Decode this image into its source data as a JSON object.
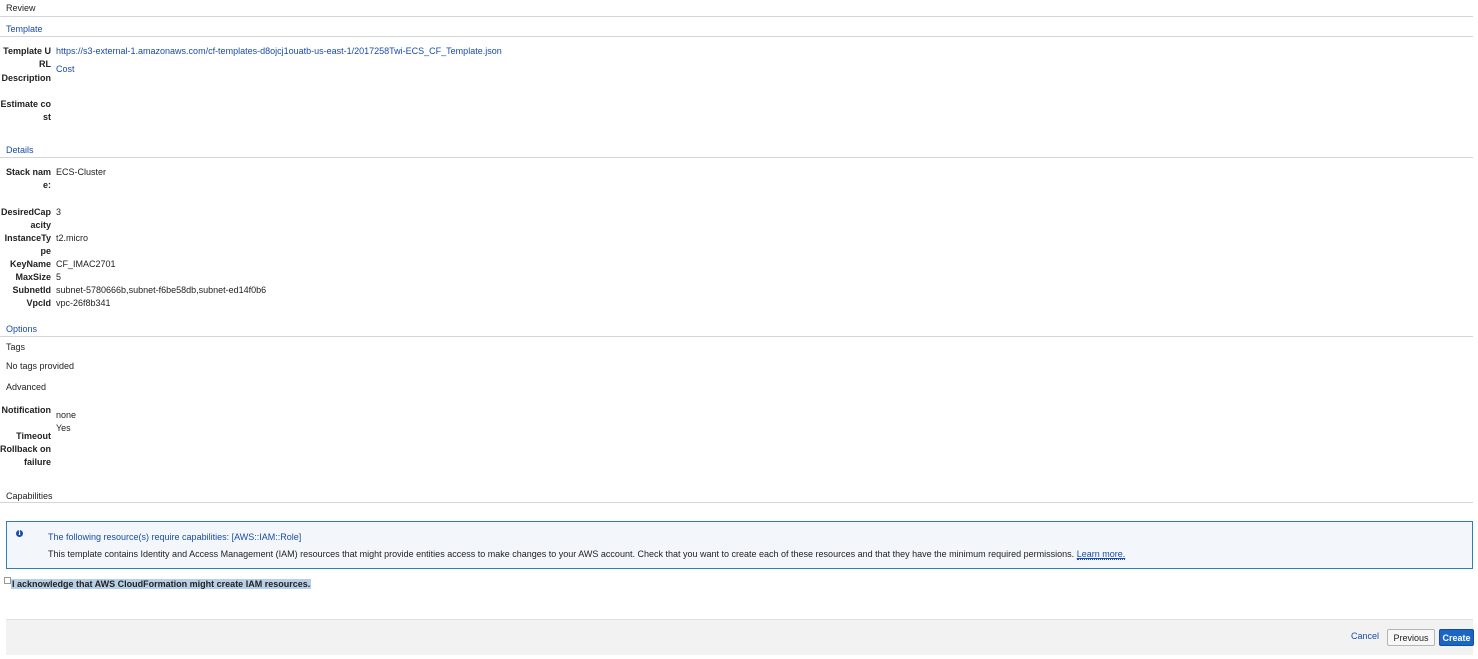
{
  "page": {
    "title": "Review"
  },
  "template_section": {
    "heading": "Template",
    "rows": [
      {
        "label": "Template URL",
        "value": "https://s3-external-1.amazonaws.com/cf-templates-d8ojcj1ouatb-us-east-1/2017258Twi-ECS_CF_Template.json"
      },
      {
        "label": "Description",
        "value": "Cost"
      },
      {
        "label": "Estimate cost",
        "value": ""
      }
    ]
  },
  "details_section": {
    "heading": "Details",
    "stack_name": {
      "label": "Stack name:",
      "value": "ECS-Cluster"
    },
    "parameters": [
      {
        "label": "DesiredCapacity",
        "value": "3"
      },
      {
        "label": "InstanceType",
        "value": "t2.micro"
      },
      {
        "label": "KeyName",
        "value": "CF_IMAC2701"
      },
      {
        "label": "MaxSize",
        "value": "5"
      },
      {
        "label": "SubnetId",
        "value": "subnet-5780666b,subnet-f6be58db,subnet-ed14f0b6"
      },
      {
        "label": "VpcId",
        "value": "vpc-26f8b341"
      }
    ]
  },
  "options_section": {
    "heading": "Options",
    "tags_heading": "Tags",
    "tags_text": "No tags provided",
    "advanced_heading": "Advanced",
    "advanced_rows": [
      {
        "label": "Notification",
        "value": "none"
      },
      {
        "label": "Timeout",
        "value": "Yes"
      },
      {
        "label": "Rollback on failure",
        "value": ""
      }
    ]
  },
  "capabilities_section": {
    "heading": "Capabilities",
    "info_icon": "info-icon",
    "info_title": "The following resource(s) require capabilities: [AWS::IAM::Role]",
    "info_body": "This template contains Identity and Access Management (IAM) resources that might provide entities access to make changes to your AWS account. Check that you want to create each of these resources and that they have the minimum required permissions.",
    "learn_more": "Learn more.",
    "acknowledge_label": "I acknowledge that AWS CloudFormation might create IAM resources.",
    "acknowledge_checked": false
  },
  "footer": {
    "cancel_label": "Cancel",
    "previous_label": "Previous",
    "create_label": "Create"
  },
  "colors": {
    "link": "#1a4ba8",
    "primary_button": "#1a66c2",
    "info_border": "#2d7fb8"
  }
}
